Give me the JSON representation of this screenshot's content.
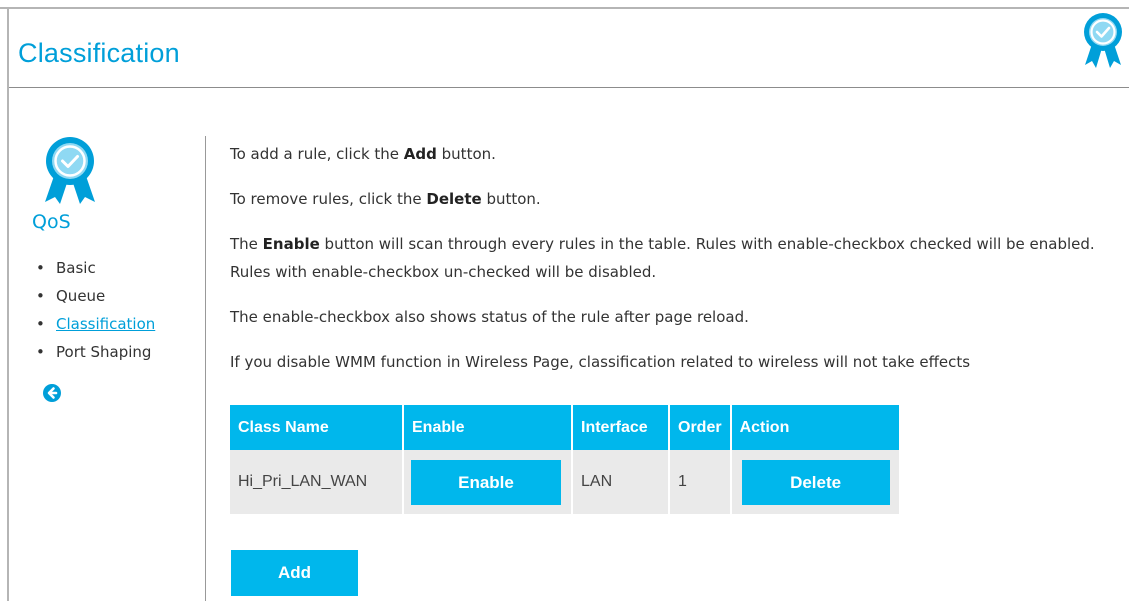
{
  "page": {
    "title": "Classification"
  },
  "sidebar": {
    "section_title": "QoS",
    "items": [
      {
        "label": "Basic",
        "active": false
      },
      {
        "label": "Queue",
        "active": false
      },
      {
        "label": "Classification",
        "active": true
      },
      {
        "label": "Port Shaping",
        "active": false
      }
    ],
    "back_icon": "arrow-left-circle-icon"
  },
  "instructions": {
    "add_pre": "To add a rule, click the ",
    "add_bold": "Add",
    "add_post": " button.",
    "delete_pre": "To remove rules, click the ",
    "delete_bold": "Delete",
    "delete_post": " button.",
    "enable_pre": "The ",
    "enable_bold": "Enable",
    "enable_post": " button will scan through every rules in the table. Rules with enable-checkbox checked will be enabled. Rules with enable-checkbox un-checked will be disabled.",
    "status": "The enable-checkbox also shows status of the rule after page reload.",
    "wmm": "If you disable WMM function in Wireless Page, classification related to wireless will not take effects"
  },
  "table": {
    "headers": [
      "Class Name",
      "Enable",
      "Interface",
      "Order",
      "Action"
    ],
    "rows": [
      {
        "class_name": "Hi_Pri_LAN_WAN",
        "enable_label": "Enable",
        "interface": "LAN",
        "order": "1",
        "action_label": "Delete"
      }
    ]
  },
  "buttons": {
    "add_label": "Add"
  },
  "colors": {
    "accent": "#00b7ec",
    "title": "#009fd9",
    "row_bg": "#eaeaea"
  }
}
